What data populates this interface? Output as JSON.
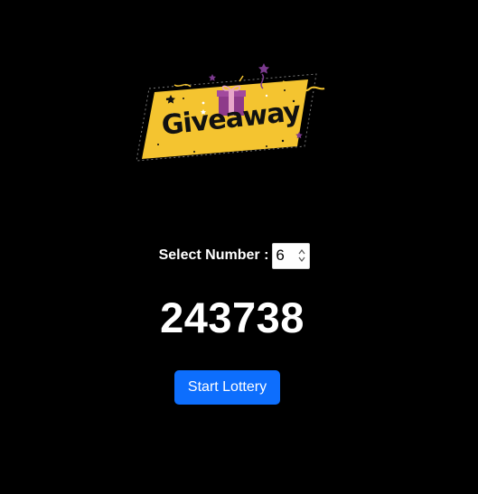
{
  "logo": {
    "text": "Giveaway",
    "colors": {
      "banner": "#F4C430",
      "gift": "#8E3A8A",
      "gift_ribbon": "#E8A6C9",
      "text": "#111111",
      "accent_stars": "#7B3A8E",
      "confetti": "#F4C430"
    }
  },
  "selector": {
    "label": "Select Number :",
    "value": "6"
  },
  "result": {
    "number": "243738"
  },
  "button": {
    "label": "Start Lottery",
    "color": "#0D6EFD"
  },
  "page": {
    "background": "#000000"
  }
}
